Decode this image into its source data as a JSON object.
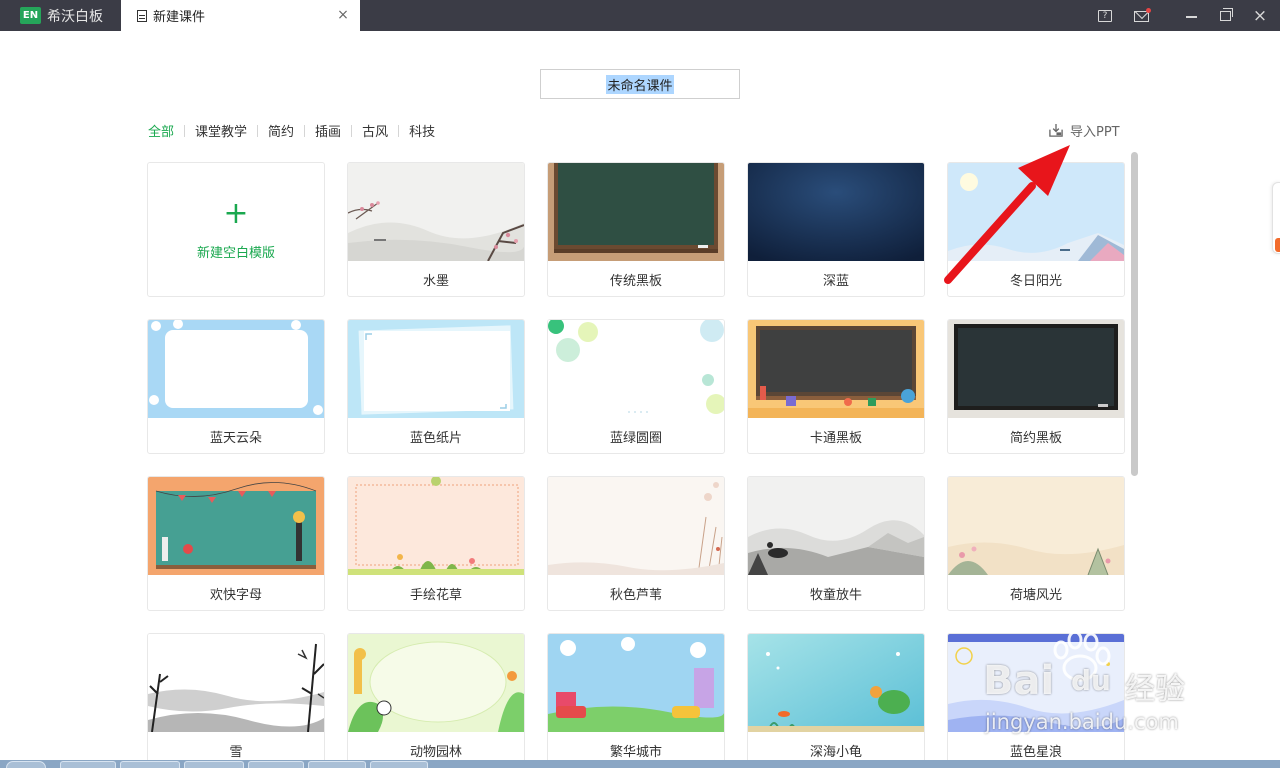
{
  "titlebar": {
    "app_name": "希沃白板",
    "app_logo_text": "EN",
    "doc_tab": "新建课件",
    "close_glyph": "×",
    "help_glyph": "?",
    "icons": [
      "help-icon",
      "mail-icon",
      "minimize-icon",
      "restore-icon",
      "close-window-icon"
    ]
  },
  "course_name": {
    "value": "未命名课件"
  },
  "categories": [
    "全部",
    "课堂教学",
    "简约",
    "插画",
    "古风",
    "科技"
  ],
  "active_category": "全部",
  "import_ppt": {
    "label": "导入PPT"
  },
  "new_template": {
    "plus": "+",
    "label": "新建空白模版"
  },
  "templates": [
    {
      "label": "水墨"
    },
    {
      "label": "传统黑板"
    },
    {
      "label": "深蓝"
    },
    {
      "label": "冬日阳光"
    },
    {
      "label": "蓝天云朵"
    },
    {
      "label": "蓝色纸片"
    },
    {
      "label": "蓝绿圆圈"
    },
    {
      "label": "卡通黑板"
    },
    {
      "label": "简约黑板"
    },
    {
      "label": "欢快字母"
    },
    {
      "label": "手绘花草"
    },
    {
      "label": "秋色芦苇"
    },
    {
      "label": "牧童放牛"
    },
    {
      "label": "荷塘风光"
    },
    {
      "label": "雪"
    },
    {
      "label": "动物园林"
    },
    {
      "label": "繁华城市"
    },
    {
      "label": "深海小龟"
    },
    {
      "label": "蓝色星浪"
    }
  ],
  "watermark": {
    "logo": "Bai",
    "logo_du": "du",
    "brand": "经验",
    "url": "jingyan.baidu.com"
  },
  "colors": {
    "accent": "#1aa84f",
    "titlebar": "#3b3c46",
    "arrow": "#e8151b"
  }
}
